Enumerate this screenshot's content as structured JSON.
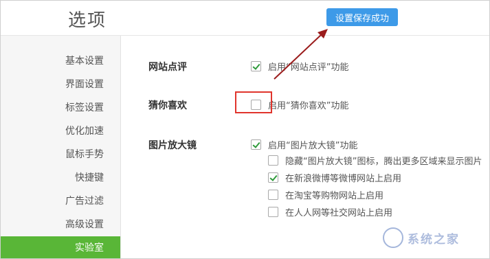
{
  "header": {
    "title": "选项",
    "toast": "设置保存成功"
  },
  "sidebar": {
    "items": [
      {
        "label": "基本设置",
        "active": false
      },
      {
        "label": "界面设置",
        "active": false
      },
      {
        "label": "标签设置",
        "active": false
      },
      {
        "label": "优化加速",
        "active": false
      },
      {
        "label": "鼠标手势",
        "active": false
      },
      {
        "label": "快捷键",
        "active": false
      },
      {
        "label": "广告过滤",
        "active": false
      },
      {
        "label": "高级设置",
        "active": false
      },
      {
        "label": "实验室",
        "active": true
      }
    ]
  },
  "sections": [
    {
      "label": "网站点评",
      "options": [
        {
          "label": "启用“网站点评”功能",
          "checked": true
        }
      ]
    },
    {
      "label": "猜你喜欢",
      "options": [
        {
          "label": "启用“猜你喜欢”功能",
          "checked": false
        }
      ]
    },
    {
      "label": "图片放大镜",
      "options": [
        {
          "label": "启用“图片放大镜”功能",
          "checked": true
        },
        {
          "label": "隐藏“图片放大镜”图标，腾出更多区域来显示图片",
          "checked": false
        },
        {
          "label": "在新浪微博等微博网站上启用",
          "checked": true
        },
        {
          "label": "在淘宝等购物网站上启用",
          "checked": false
        },
        {
          "label": "在人人网等社交网站上启用",
          "checked": false
        }
      ]
    }
  ],
  "watermark": "系统之家",
  "colors": {
    "accent": "#59b637",
    "toast": "#3d9ae8",
    "highlight": "#e0342c",
    "arrow": "#9b1c1c"
  }
}
